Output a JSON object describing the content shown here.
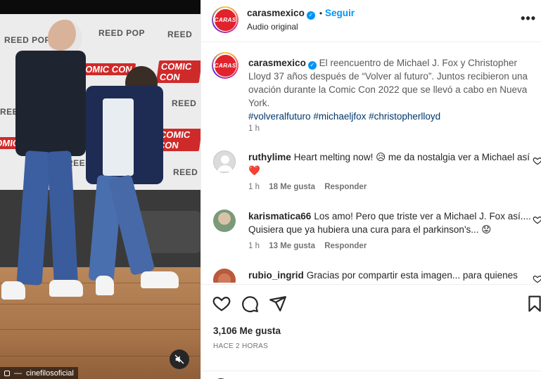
{
  "post": {
    "username": "carasmexico",
    "follow_label": "Seguir",
    "audio_label": "Audio original",
    "avatar_text": "CARAS",
    "caption": {
      "username": "carasmexico",
      "text": "El reencuentro de Michael J. Fox y Christopher Lloyd 37 años después de “Volver al futuro”. Juntos recibieron una ovación durante la Comic Con 2022 que se llevó a cabo en Nueva York.",
      "hashtags": [
        "#volveralfuturo",
        "#michaeljfox",
        "#christopherlloyd"
      ],
      "time": "1 h"
    },
    "likes_count": "3,106 Me gusta",
    "time_ago": "HACE 2 HORAS",
    "more_label": "•••",
    "separator": "•"
  },
  "comments": [
    {
      "username": "ruthylime",
      "text": "Heart melting now! 😥 me da nostalgia ver a Michael así ❤️",
      "time": "1 h",
      "likes": "18 Me gusta",
      "reply": "Responder"
    },
    {
      "username": "karismatica66",
      "text": "Los amo! Pero que triste ver a Michael J. Fox así.... Quisiera que ya hubiera una cura para el parkinson's... 😟",
      "time": "1 h",
      "likes": "13 Me gusta",
      "reply": "Responder"
    },
    {
      "username": "rubio_ingrid",
      "text": "Gracias por compartir esta imagen... para quienes",
      "time": "",
      "likes": "",
      "reply": ""
    }
  ],
  "media": {
    "watermark": "cinefilosoficial",
    "backdrop_logos": [
      "REED POP",
      "REED POP",
      "REED",
      "REED",
      "REED",
      "REED",
      "REED POP"
    ],
    "comiccon_logos": [
      "COMIC CON",
      "COMIC CON",
      "COMIC CON",
      "COMIC CON"
    ]
  },
  "icons": {
    "like": "heart-icon",
    "comment": "comment-bubble-icon",
    "share": "paper-plane-icon",
    "save": "bookmark-icon",
    "mute": "speaker-muted-icon",
    "verified": "verified-badge-icon"
  },
  "colors": {
    "follow_blue": "#0095f6",
    "hashtag_blue": "#00376b",
    "brand_red": "#e0232c",
    "muted_text": "#737373"
  }
}
